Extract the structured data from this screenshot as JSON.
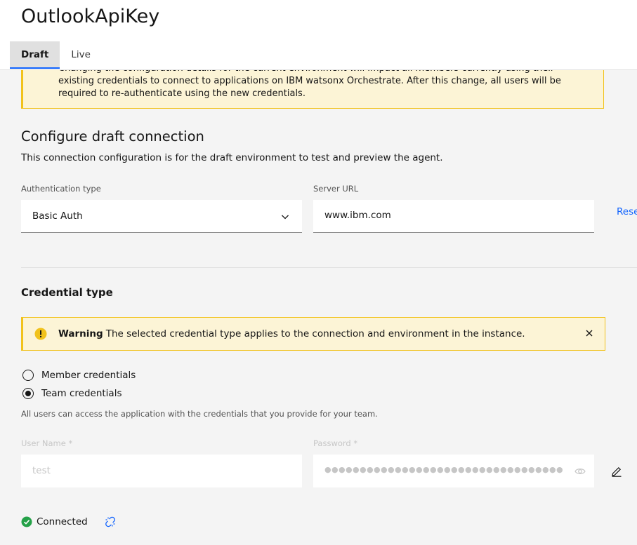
{
  "app": {
    "title": "OutlookApiKey"
  },
  "tabs": [
    {
      "label": "Draft",
      "active": true
    },
    {
      "label": "Live",
      "active": false
    }
  ],
  "notice": {
    "lines": [
      "Changing the configuration details for the current environment will impact all members currently using their",
      "existing credentials to connect to applications on IBM watsonx Orchestrate. After this change, all users will be",
      "required to re-authenticate using the new credentials."
    ]
  },
  "configure": {
    "title": "Configure draft connection",
    "description": "This connection configuration is for the draft environment to test and preview the agent.",
    "auth_label": "Authentication type",
    "auth_value": "Basic Auth",
    "server_label": "Server URL",
    "server_value": "www.ibm.com",
    "reset_label": "Rese"
  },
  "credential": {
    "title": "Credential type",
    "warning_title": "Warning",
    "warning_text": "The selected credential type applies to the connection and environment in the instance.",
    "options": [
      {
        "label": "Member credentials",
        "checked": false
      },
      {
        "label": "Team credentials",
        "checked": true
      }
    ],
    "helper": "All users can access the application with the credentials that you provide for your team.",
    "username_label": "User Name *",
    "username_value": "test",
    "password_label": "Password *",
    "password_mask": "●●●●●●●●●●●●●●●●●●●●●●●●●●●●●●●●●●●●●●●●●"
  },
  "status": {
    "text": "Connected"
  },
  "colors": {
    "accent": "#0f62fe",
    "warning_bg": "#fcf4d6",
    "warning_border": "#f1c21b",
    "success": "#24a148",
    "page_bg": "#f4f4f4"
  },
  "icons": [
    "chevron-down-icon",
    "warning-icon",
    "close-icon",
    "eye-icon",
    "edit-icon",
    "checkmark-filled-icon",
    "disconnect-icon"
  ]
}
